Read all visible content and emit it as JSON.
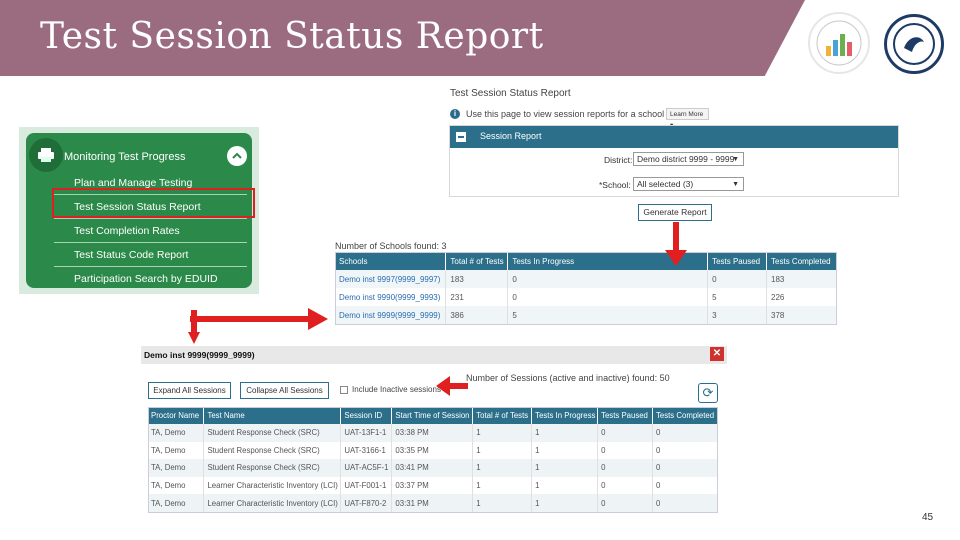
{
  "slide": {
    "title": "Test Session Status Report",
    "page_number": "45",
    "banner_color": "#9b6b7f"
  },
  "nav": {
    "header": "Monitoring Test Progress",
    "items": [
      {
        "label": "Plan and Manage Testing"
      },
      {
        "label": "Test Session Status Report",
        "highlighted": true
      },
      {
        "label": "Test Completion Rates"
      },
      {
        "label": "Test Status Code Report"
      },
      {
        "label": "Participation Search by EDUID"
      }
    ],
    "icons": {
      "header": "printer-icon",
      "collapse": "chevron-up-icon"
    }
  },
  "report": {
    "title": "Test Session Status Report",
    "info_text": "Use this page to view session reports for a school",
    "learn_more": "Learn More",
    "panel_title": "Session Report",
    "district_label": "District:",
    "district_value": "Demo district 9999 - 9999",
    "school_label": "*School:",
    "school_value": "All selected (3)",
    "generate_button": "Generate Report"
  },
  "schools": {
    "found_text": "Number of Schools found: 3",
    "columns": [
      "Schools",
      "Total # of Tests",
      "Tests In Progress",
      "Tests Paused",
      "Tests Completed"
    ],
    "rows": [
      [
        "Demo inst 9997(9999_9997)",
        "183",
        "0",
        "0",
        "183"
      ],
      [
        "Demo inst 9990(9999_9993)",
        "231",
        "0",
        "5",
        "226"
      ],
      [
        "Demo inst 9999(9999_9999)",
        "386",
        "5",
        "3",
        "378"
      ]
    ]
  },
  "sessions": {
    "header": "Demo inst 9999(9999_9999)",
    "expand_button": "Expand All Sessions",
    "collapse_button": "Collapse All Sessions",
    "include_inactive": "Include Inactive sessions",
    "found_text": "Number of Sessions (active and inactive) found: 50",
    "columns": [
      "Proctor Name",
      "Test Name",
      "Session ID",
      "Start Time of Session",
      "Total # of Tests",
      "Tests In Progress",
      "Tests Paused",
      "Tests Completed"
    ],
    "rows": [
      [
        "TA, Demo",
        "Student Response Check (SRC)",
        "UAT-13F1-1",
        "03:38 PM",
        "1",
        "1",
        "0",
        "0"
      ],
      [
        "TA, Demo",
        "Student Response Check (SRC)",
        "UAT-3166-1",
        "03:35 PM",
        "1",
        "1",
        "0",
        "0"
      ],
      [
        "TA, Demo",
        "Student Response Check (SRC)",
        "UAT-AC5F-1",
        "03:41 PM",
        "1",
        "1",
        "0",
        "0"
      ],
      [
        "TA, Demo",
        "Learner Characteristic Inventory (LCI)",
        "UAT-F001-1",
        "03:37 PM",
        "1",
        "1",
        "0",
        "0"
      ],
      [
        "TA, Demo",
        "Learner Characteristic Inventory (LCI)",
        "UAT-F870-2",
        "03:31 PM",
        "1",
        "1",
        "0",
        "0"
      ]
    ]
  },
  "colors": {
    "accent": "#2c6f8a",
    "nav_green": "#2b8a4a",
    "arrow_red": "#e02020"
  }
}
